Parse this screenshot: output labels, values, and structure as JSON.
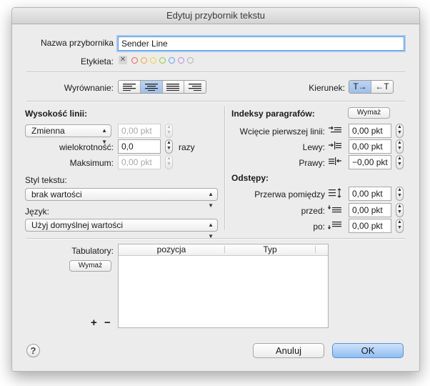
{
  "window": {
    "title": "Edytuj przybornik tekstu"
  },
  "top": {
    "name_label": "Nazwa przybornika",
    "name_value": "Sender Line",
    "tag_label": "Etykieta:",
    "tag_colors": [
      "#f05a5a",
      "#f4a332",
      "#f2d13a",
      "#8ecb3f",
      "#5a9df0",
      "#c286e0",
      "#b0b0b0"
    ]
  },
  "alignment": {
    "label": "Wyrównanie:",
    "selected": "center"
  },
  "direction": {
    "label": "Kierunek:",
    "ltr": "T→",
    "rtl": "←T"
  },
  "line_height": {
    "heading": "Wysokość linii:",
    "mode": "Zmienna",
    "mode_value": "0,00 pkt",
    "multiple_label": "wielokrotność:",
    "multiple_value": "0,0",
    "multiple_unit": "razy",
    "max_label": "Maksimum:",
    "max_value": "0,00 pkt"
  },
  "text_style": {
    "label": "Styl tekstu:",
    "value": "brak wartości"
  },
  "language": {
    "label": "Język:",
    "value": "Użyj domyślnej wartości"
  },
  "indents": {
    "heading": "Indeksy paragrafów:",
    "clear": "Wymaż",
    "first_label": "Wcięcie pierwszej linii:",
    "first_value": "0,00 pkt",
    "left_label": "Lewy:",
    "left_value": "0,00 pkt",
    "right_label": "Prawy:",
    "right_value": "−0,00 pkt"
  },
  "spacing": {
    "heading": "Odstępy:",
    "between_label": "Przerwa pomiędzy",
    "between_value": "0,00 pkt",
    "before_label": "przed:",
    "before_value": "0,00 pkt",
    "after_label": "po:",
    "after_value": "0,00 pkt"
  },
  "tabs": {
    "label": "Tabulatory:",
    "clear": "Wymaż",
    "columns": [
      "pozycja",
      "Typ"
    ],
    "add": "+",
    "remove": "−"
  },
  "footer": {
    "help": "?",
    "cancel": "Anuluj",
    "ok": "OK"
  }
}
